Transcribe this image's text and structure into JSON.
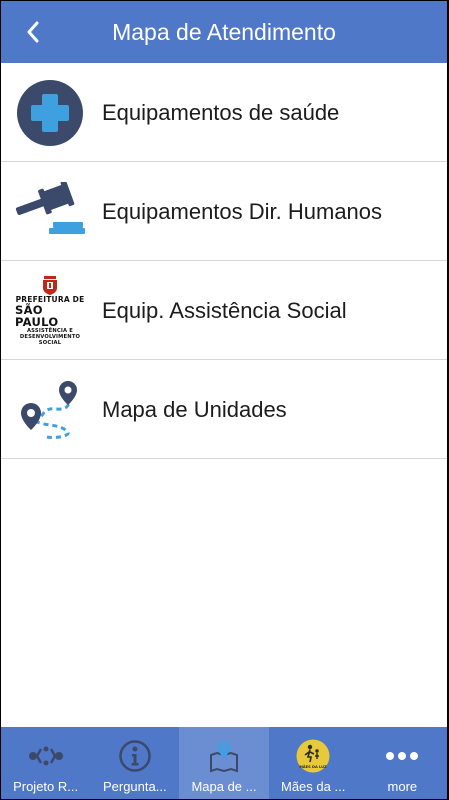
{
  "header": {
    "title": "Mapa de Atendimento",
    "color": "#4f78c9"
  },
  "items": [
    {
      "label": "Equipamentos de saúde",
      "icon": "health-cross-icon"
    },
    {
      "label": "Equipamentos Dir. Humanos",
      "icon": "gavel-icon"
    },
    {
      "label": "Equip. Assistência Social",
      "icon": "prefeitura-sao-paulo-logo"
    },
    {
      "label": "Mapa de Unidades",
      "icon": "map-route-icon"
    }
  ],
  "logo": {
    "line1": "PREFEITURA DE",
    "line2": "SÃO PAULO",
    "line3": "ASSISTÊNCIA E",
    "line4": "DESENVOLVIMENTO",
    "line5": "SOCIAL"
  },
  "tabs": [
    {
      "label": "Projeto R...",
      "icon": "network-icon"
    },
    {
      "label": "Pergunta...",
      "icon": "info-icon"
    },
    {
      "label": "Mapa de ...",
      "icon": "map-pin-icon",
      "active": true
    },
    {
      "label": "Mães da ...",
      "icon": "maes-da-luz-logo-icon",
      "icon_text": "MÃES DA LUZ"
    },
    {
      "label": "more",
      "icon": "more-dots-icon"
    }
  ]
}
